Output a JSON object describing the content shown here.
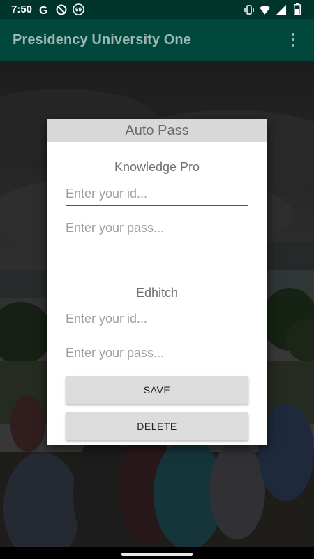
{
  "status_bar": {
    "time": "7:50",
    "left_icons": [
      "google-icon",
      "do-not-disturb-icon",
      "badge-69-icon"
    ],
    "badge_count": "69",
    "right_icons": [
      "vibrate-icon",
      "wifi-icon",
      "signal-icon",
      "battery-icon"
    ]
  },
  "app_bar": {
    "title": "Presidency University One",
    "background": "#00483c"
  },
  "dialog": {
    "title": "Auto Pass",
    "sections": [
      {
        "title": "Knowledge Pro",
        "id_placeholder": "Enter your id...",
        "pass_placeholder": "Enter your pass..."
      },
      {
        "title": "Edhitch",
        "id_placeholder": "Enter your id...",
        "pass_placeholder": "Enter your pass..."
      }
    ],
    "save_label": "SAVE",
    "delete_label": "DELETE"
  }
}
